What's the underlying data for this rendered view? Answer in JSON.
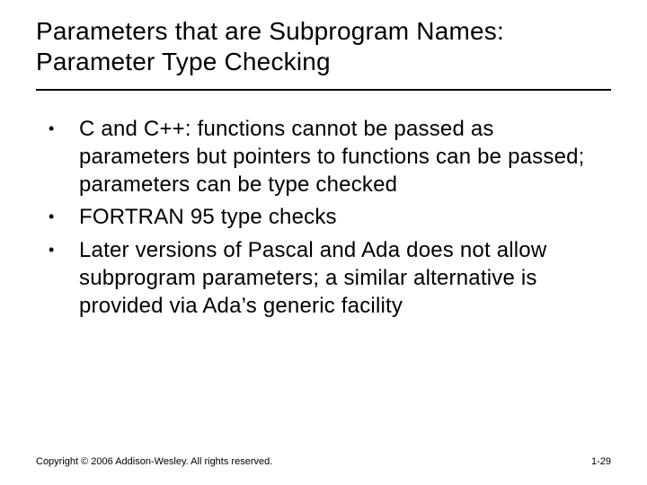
{
  "title": "Parameters that are Subprogram Names: Parameter Type Checking",
  "bullets": [
    "C and C++: functions cannot be passed as parameters but pointers to functions can be passed; parameters can be type checked",
    "FORTRAN 95 type checks",
    "Later versions of Pascal and Ada does not allow subprogram parameters; a similar alternative is provided via Ada’s generic facility"
  ],
  "footer": {
    "copyright": "Copyright © 2006 Addison-Wesley. All rights reserved.",
    "page": "1-29"
  }
}
